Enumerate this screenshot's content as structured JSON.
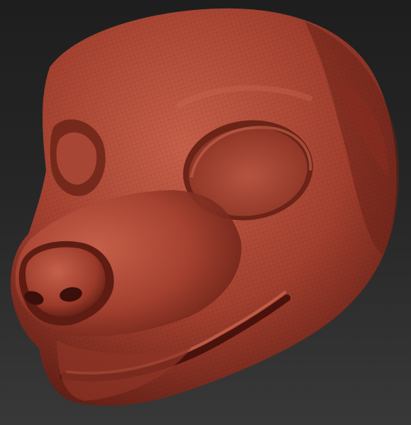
{
  "scene": {
    "subject": "sculpt-head",
    "colors": {
      "background_top": "#1e1e1e",
      "background_bottom": "#383838",
      "clay_base": "#a4402f",
      "clay_light": "#c6604a",
      "clay_dark": "#5a1a12",
      "clay_shadow": "#3b0f0b",
      "wire": "#000000"
    }
  }
}
